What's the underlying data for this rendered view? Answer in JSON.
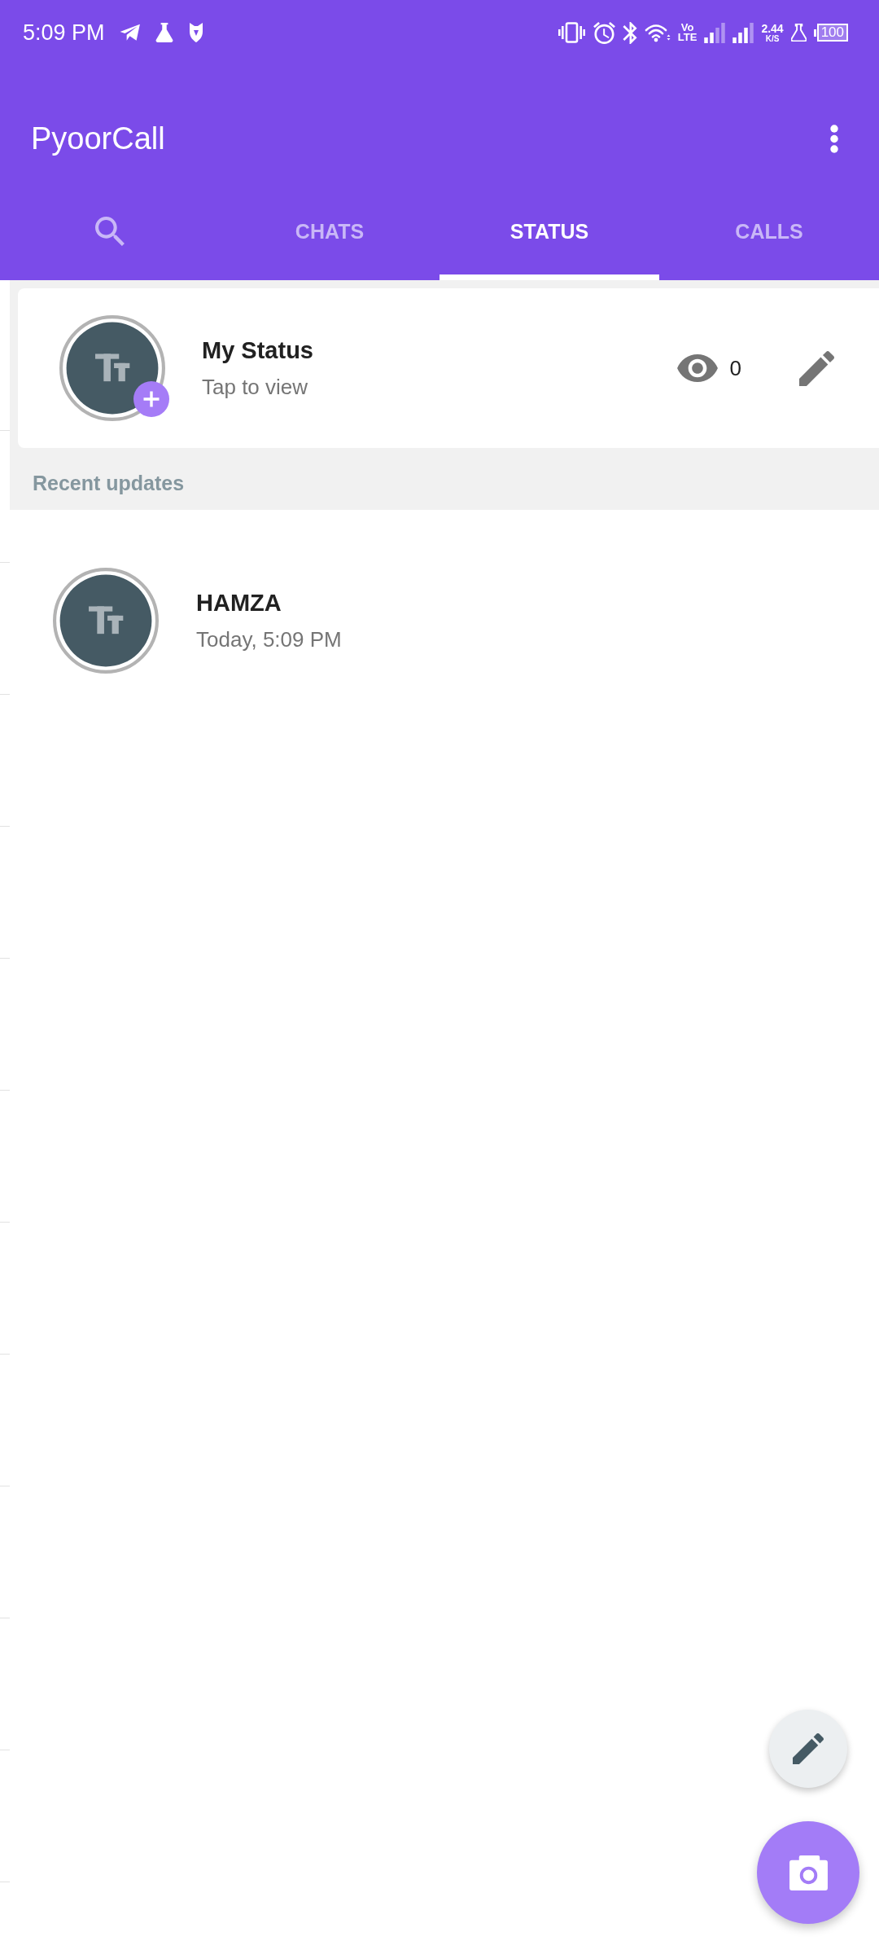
{
  "status_bar": {
    "time": "5:09 PM",
    "network_type": "Vo\nLTE",
    "speed": "2.44",
    "speed_unit": "K/S",
    "battery": "100"
  },
  "app_bar": {
    "title": "PyoorCall"
  },
  "tabs": [
    {
      "kind": "search",
      "selected": false
    },
    {
      "kind": "text",
      "label": "CHATS",
      "selected": false
    },
    {
      "kind": "text",
      "label": "STATUS",
      "selected": true
    },
    {
      "kind": "text",
      "label": "CALLS",
      "selected": false
    }
  ],
  "my_status": {
    "name": "My Status",
    "subtitle": "Tap to view",
    "view_count": "0"
  },
  "recent_updates": {
    "header": "Recent updates",
    "items": [
      {
        "name": "HAMZA",
        "time": "Today, 5:09 PM",
        "seen": true
      }
    ]
  }
}
